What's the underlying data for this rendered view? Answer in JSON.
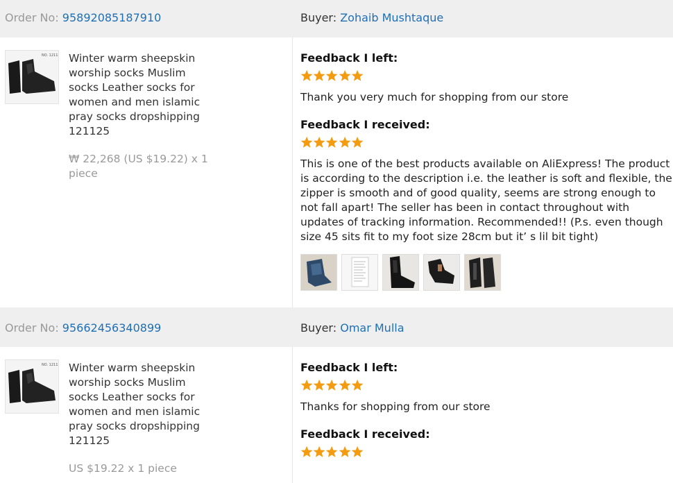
{
  "colors": {
    "link": "#1f6fb5",
    "star": "#f39c12",
    "header_bg": "#efefef",
    "muted": "#999999"
  },
  "labels": {
    "order_no": "Order No:",
    "buyer": "Buyer:",
    "feedback_left": "Feedback I left:",
    "feedback_received": "Feedback I received:"
  },
  "orders": [
    {
      "order_number": "95892085187910",
      "buyer_name": "Zohaib Mushtaque",
      "product_title": "Winter warm sheepskin worship socks Muslim socks Leather socks for women and men islamic pray socks dropshipping 121125",
      "price": "₩ 22,268 (US $19.22) x 1 piece",
      "feedback_left_stars": 5,
      "feedback_left_text": "Thank you very much for shopping from our store",
      "feedback_received_stars": 5,
      "feedback_received_text": "This is one of the best products available on AliExpress! The product is according to the description i.e. the leather is soft and flexible, the zipper is smooth and of good quality, seems are strong enough to not fall apart! The seller has been in contact throughout with updates of tracking information. Recommended!! (P.s. even though size 45 sits fit to my foot size 28cm but it’ s lil bit tight)",
      "photos": [
        "blue-boot-photo",
        "receipt-photo",
        "black-boot-photo",
        "boot-on-foot-photo",
        "boot-detail-photo"
      ]
    },
    {
      "order_number": "95662456340899",
      "buyer_name": "Omar Mulla",
      "product_title": "Winter warm sheepskin worship socks Muslim socks Leather socks for women and men islamic pray socks dropshipping 121125",
      "price": "US $19.22 x 1 piece",
      "feedback_left_stars": 5,
      "feedback_left_text": "Thanks for shopping from our store",
      "feedback_received_stars": 5
    }
  ]
}
